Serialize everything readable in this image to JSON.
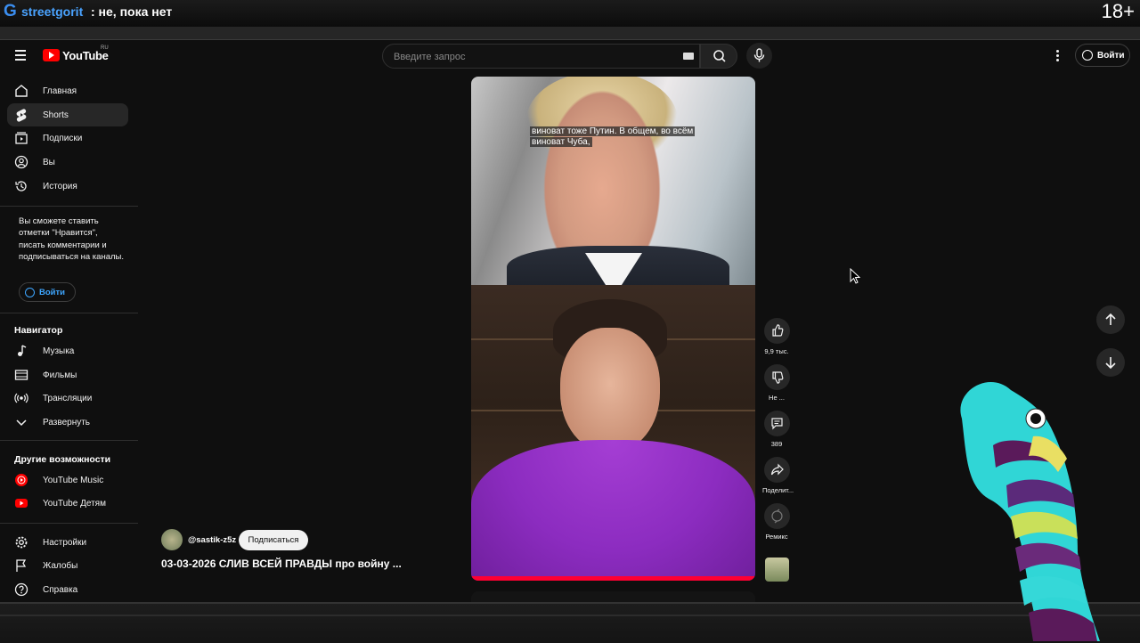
{
  "overlay": {
    "brand": "streetgorit",
    "status": ": не, пока нет",
    "age_rating": "18+"
  },
  "header": {
    "logo_text": "YouTube",
    "logo_region": "RU",
    "search_placeholder": "Введите запрос",
    "login_label": "Войти"
  },
  "sidebar": {
    "main_items": [
      {
        "label": "Главная",
        "icon": "home-icon"
      },
      {
        "label": "Shorts",
        "icon": "shorts-icon",
        "active": true
      },
      {
        "label": "Подписки",
        "icon": "subscriptions-icon"
      },
      {
        "label": "Вы",
        "icon": "you-icon"
      },
      {
        "label": "История",
        "icon": "history-icon"
      }
    ],
    "signin_note": "Вы сможете ставить отметки \"Нравится\", писать комментарии и подписываться на каналы.",
    "signin_button": "Войти",
    "navigator_title": "Навигатор",
    "navigator_items": [
      {
        "label": "Музыка",
        "icon": "music-icon"
      },
      {
        "label": "Фильмы",
        "icon": "movies-icon"
      },
      {
        "label": "Трансляции",
        "icon": "live-icon"
      },
      {
        "label": "Развернуть",
        "icon": "chevron-down-icon"
      }
    ],
    "more_title": "Другие возможности",
    "more_items": [
      {
        "label": "YouTube Music",
        "icon": "youtube-music-icon"
      },
      {
        "label": "YouTube Детям",
        "icon": "youtube-kids-icon"
      }
    ],
    "footer_items": [
      {
        "label": "Настройки",
        "icon": "gear-icon"
      },
      {
        "label": "Жалобы",
        "icon": "flag-icon"
      },
      {
        "label": "Справка",
        "icon": "help-icon"
      }
    ]
  },
  "video": {
    "caption_line1": "виноват тоже Путин. В общем, во всём",
    "caption_line2": "виноват Чуба,",
    "channel": "@sastik-z5z",
    "subscribe_label": "Подписаться",
    "title": "03-03-2026 СЛИВ ВСЕЙ ПРАВДЫ про войну ..."
  },
  "actions": {
    "likes": "9,9 тыс.",
    "dislike": "Не ...",
    "comments": "389",
    "share": "Поделит...",
    "remix": "Ремикс"
  },
  "colors": {
    "accent_red": "#ff0000",
    "link_blue": "#3ea6ff",
    "background": "#0f0f0f"
  }
}
